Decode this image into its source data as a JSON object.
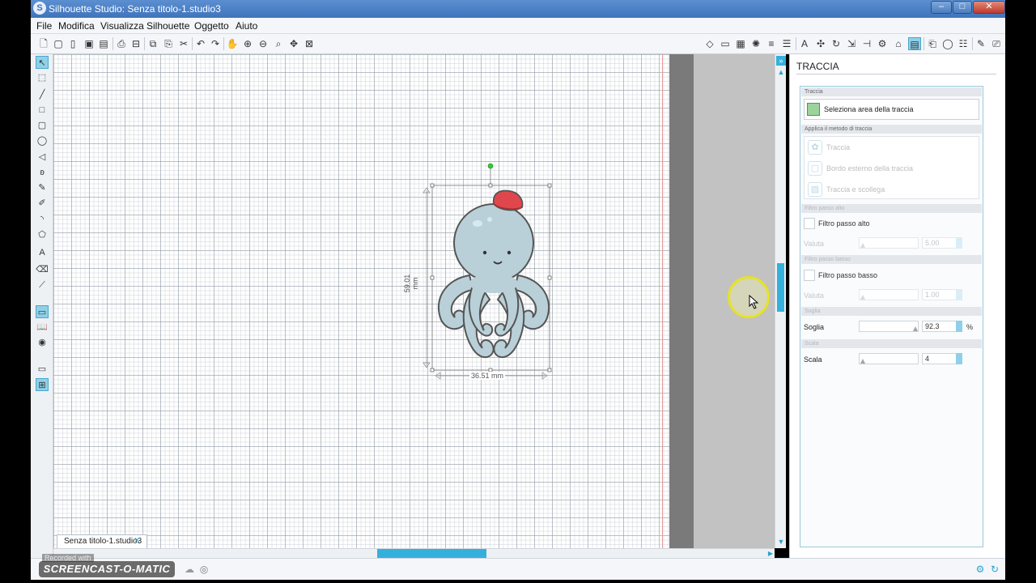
{
  "window": {
    "title": "Silhouette Studio: Senza titolo-1.studio3"
  },
  "menu": [
    "File",
    "Modifica",
    "Visualizza",
    "Silhouette",
    "Oggetto",
    "Aiuto"
  ],
  "toolbar_left": [
    "new-file-icon",
    "open-file-icon",
    "recent-file-icon",
    "save-icon",
    "save-as-icon",
    "print-icon",
    "send-to-cutter-icon",
    "copy-icon",
    "paste-icon",
    "cut-icon",
    "undo-icon",
    "redo-icon",
    "pan-hand-icon",
    "zoom-in-icon",
    "zoom-out-icon",
    "zoom-selection-icon",
    "zoom-drag-icon",
    "fit-to-page-icon"
  ],
  "toolbar_right": [
    "fill-color-icon",
    "line-color-icon",
    "fill-gradient-icon",
    "fill-pattern-icon",
    "line-style-icon",
    "line-settings-icon",
    "text-style-icon",
    "transform-icon",
    "rotate-icon",
    "scale-icon",
    "align-icon",
    "replicate-icon",
    "trace-icon",
    "offset-icon",
    "modify-icon",
    "library-icon",
    "cut-settings-icon",
    "store-icon"
  ],
  "tools": [
    "select-icon",
    "edit-points-icon",
    "line-tool-icon",
    "rectangle-tool-icon",
    "rounded-rectangle-icon",
    "ellipse-tool-icon",
    "polygon-tool-icon",
    "curve-tool-icon",
    "freehand-tool-icon",
    "smooth-freehand-icon",
    "arc-tool-icon",
    "regular-polygon-icon",
    "text-tool-icon",
    "eraser-icon",
    "knife-icon",
    "page-setup-icon",
    "library-view-icon",
    "online-store-icon",
    "registration-icon",
    "grid-icon"
  ],
  "document": {
    "tab_label": "Senza titolo-1.studio3",
    "height_dimension": "59.01 mm",
    "width_dimension": "36.51 mm"
  },
  "panel": {
    "title": "TRACCIA",
    "section_trace_area": "Traccia",
    "select_area_button": "Seleziona area della traccia",
    "section_method": "Applica il metodo di traccia",
    "methods": [
      "Traccia",
      "Bordo esterno della traccia",
      "Traccia e scollega"
    ],
    "section_high_pass": "Filtro passo alto",
    "high_pass_checkbox": "Filtro passo alto",
    "value_label": "Valuta",
    "high_pass_value": "5.00",
    "section_low_pass": "Filtro passo basso",
    "low_pass_checkbox": "Filtro passo basso",
    "low_pass_value": "1.00",
    "section_threshold": "Soglia",
    "threshold_label": "Soglia",
    "threshold_value": "92.3",
    "threshold_unit": "%",
    "section_scale": "Scala",
    "scale_label": "Scala",
    "scale_value": "4"
  },
  "statusbar": {
    "recorded_with": "Recorded with",
    "brand": "SCREENCAST-O-MATIC"
  },
  "colors": {
    "accent": "#35b0dc",
    "titlebar": "#4a7dc4",
    "octopus_body": "#b9d0d8",
    "hat": "#e0474c"
  }
}
